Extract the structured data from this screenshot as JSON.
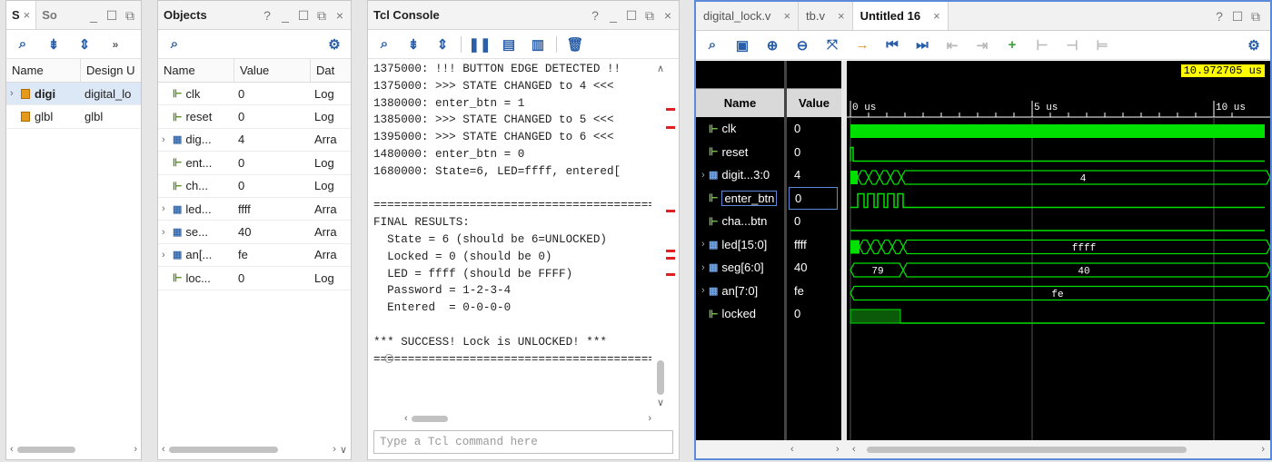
{
  "scope_panel": {
    "tab_active": "S",
    "tab_other": "So",
    "headers": [
      "Name",
      "Design U"
    ],
    "rows": [
      {
        "name": "digi",
        "design": "digital_lo",
        "expandable": true
      },
      {
        "name": "glbl",
        "design": "glbl",
        "expandable": false
      }
    ]
  },
  "objects_panel": {
    "title": "Objects",
    "headers": [
      "Name",
      "Value",
      "Dat"
    ],
    "rows": [
      {
        "name": "clk",
        "value": "0",
        "type": "Log",
        "bus": false
      },
      {
        "name": "reset",
        "value": "0",
        "type": "Log",
        "bus": false
      },
      {
        "name": "dig...",
        "value": "4",
        "type": "Arra",
        "bus": true
      },
      {
        "name": "ent...",
        "value": "0",
        "type": "Log",
        "bus": false
      },
      {
        "name": "ch...",
        "value": "0",
        "type": "Log",
        "bus": false
      },
      {
        "name": "led...",
        "value": "ffff",
        "type": "Arra",
        "bus": true
      },
      {
        "name": "se...",
        "value": "40",
        "type": "Arra",
        "bus": true
      },
      {
        "name": "an[...",
        "value": "fe",
        "type": "Arra",
        "bus": true
      },
      {
        "name": "loc...",
        "value": "0",
        "type": "Log",
        "bus": false
      }
    ]
  },
  "tcl_console": {
    "title": "Tcl Console",
    "lines": [
      "1375000: !!! BUTTON EDGE DETECTED !!",
      "1375000: >>> STATE CHANGED to 4 <<<",
      "1380000: enter_btn = 1",
      "1385000: >>> STATE CHANGED to 5 <<<",
      "1395000: >>> STATE CHANGED to 6 <<<",
      "1480000: enter_btn = 0",
      "1680000: State=6, LED=ffff, entered[",
      "",
      "==========================================",
      "FINAL RESULTS:",
      "  State = 6 (should be 6=UNLOCKED)",
      "  Locked = 0 (should be 0)",
      "  LED = ffff (should be FFFF)",
      "  Password = 1-2-3-4",
      "  Entered  = 0-0-0-0",
      "",
      "*** SUCCESS! Lock is UNLOCKED! ***",
      "=========================================="
    ],
    "input_placeholder": "Type a Tcl command here"
  },
  "wave_window": {
    "tabs": [
      {
        "label": "digital_lock.v",
        "active": false
      },
      {
        "label": "tb.v",
        "active": false
      },
      {
        "label": "Untitled 16",
        "active": true
      }
    ],
    "name_header": "Name",
    "value_header": "Value",
    "cursor_time": "10.972705 us",
    "time_ticks": [
      "0 us",
      "5 us",
      "10 us"
    ],
    "signals": [
      {
        "name": "clk",
        "value": "0",
        "bus": false
      },
      {
        "name": "reset",
        "value": "0",
        "bus": false
      },
      {
        "name": "digit...3:0",
        "value": "4",
        "bus": true,
        "wave_label": "4"
      },
      {
        "name": "enter_btn",
        "value": "0",
        "bus": false
      },
      {
        "name": "cha...btn",
        "value": "0",
        "bus": false
      },
      {
        "name": "led[15:0]",
        "value": "ffff",
        "bus": true,
        "wave_label": "ffff"
      },
      {
        "name": "seg[6:0]",
        "value": "40",
        "bus": true,
        "wave_label": "40",
        "wave_label_early": "79"
      },
      {
        "name": "an[7:0]",
        "value": "fe",
        "bus": true,
        "wave_label": "fe"
      },
      {
        "name": "locked",
        "value": "0",
        "bus": false
      }
    ]
  },
  "colors": {
    "wave_green": "#00e000",
    "cursor_yellow": "#ffff00",
    "accent_blue": "#2a5fa8"
  }
}
